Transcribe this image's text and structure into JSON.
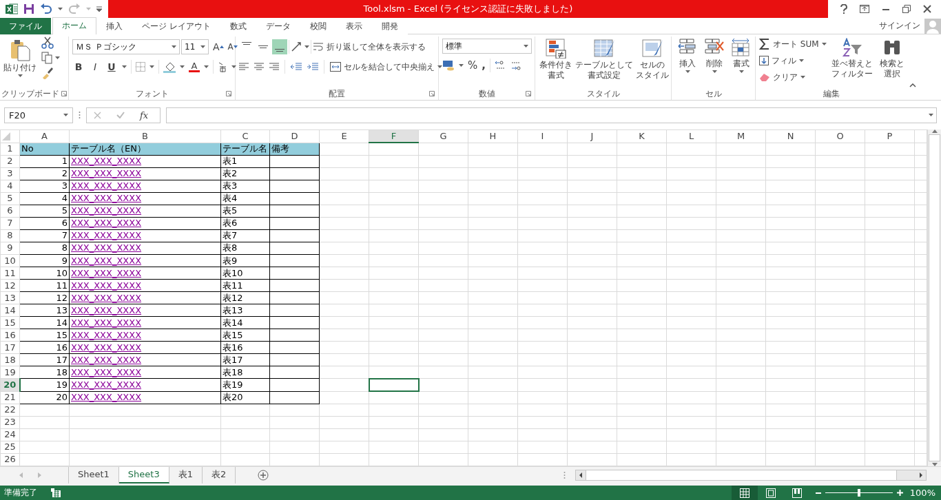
{
  "title_bar": {
    "title": "Tool.xlsm -  Excel (ライセンス認証に失敗しました)"
  },
  "ribbon_tabs": [
    {
      "label": "ファイル",
      "kind": "file",
      "selected": false
    },
    {
      "label": "ホーム",
      "kind": "tab",
      "selected": true
    },
    {
      "label": "挿入",
      "kind": "tab",
      "selected": false
    },
    {
      "label": "ページ レイアウト",
      "kind": "tab",
      "selected": false
    },
    {
      "label": "数式",
      "kind": "tab",
      "selected": false
    },
    {
      "label": "データ",
      "kind": "tab",
      "selected": false
    },
    {
      "label": "校閲",
      "kind": "tab",
      "selected": false
    },
    {
      "label": "表示",
      "kind": "tab",
      "selected": false
    },
    {
      "label": "開発",
      "kind": "tab",
      "selected": false
    }
  ],
  "account": {
    "label": "サインイン"
  },
  "clipboard": {
    "paste": "貼り付け",
    "group": "クリップボード"
  },
  "font": {
    "name": "ＭＳ Ｐゴシック",
    "size": "11",
    "grow": "A",
    "shrink": "A",
    "font_color": "A",
    "group": "フォント",
    "style_buttons": [
      {
        "label": "B",
        "kind": "bold"
      },
      {
        "label": "I",
        "kind": "italic"
      },
      {
        "label": "U",
        "kind": "underline"
      }
    ]
  },
  "alignment": {
    "wrap": "折り返して全体を表示する",
    "merge": "セルを結合して中央揃え",
    "group": "配置",
    "vertical_buttons": [
      {
        "kind": "top",
        "selected": false
      },
      {
        "kind": "middle",
        "selected": false
      },
      {
        "kind": "bottom",
        "selected": true
      }
    ]
  },
  "number": {
    "format": "標準",
    "percent": "%",
    "comma": ",",
    "group": "数値"
  },
  "styles": {
    "buttons": [
      {
        "lines": [
          "条件付き",
          "書式"
        ]
      },
      {
        "lines": [
          "テーブルとして",
          "書式設定"
        ]
      },
      {
        "lines": [
          "セルの",
          "スタイル"
        ]
      }
    ],
    "group": "スタイル"
  },
  "cells_group": {
    "buttons": [
      "挿入",
      "削除",
      "書式"
    ],
    "group": "セル"
  },
  "editing": {
    "autosum": "オート SUM",
    "fill": "フィル",
    "clear": "クリア",
    "sort": [
      "並べ替えと",
      "フィルター"
    ],
    "find": [
      "検索と",
      "選択"
    ],
    "group": "編集"
  },
  "formula_bar": {
    "name_box": "F20",
    "fx": "fx"
  },
  "sheet": {
    "columns": [
      {
        "label": "A",
        "selected": false
      },
      {
        "label": "B",
        "selected": false
      },
      {
        "label": "C",
        "selected": false
      },
      {
        "label": "D",
        "selected": false
      },
      {
        "label": "E",
        "selected": false
      },
      {
        "label": "F",
        "selected": true
      },
      {
        "label": "G",
        "selected": false
      },
      {
        "label": "H",
        "selected": false
      },
      {
        "label": "I",
        "selected": false
      },
      {
        "label": "J",
        "selected": false
      },
      {
        "label": "K",
        "selected": false
      },
      {
        "label": "L",
        "selected": false
      },
      {
        "label": "M",
        "selected": false
      },
      {
        "label": "N",
        "selected": false
      },
      {
        "label": "O",
        "selected": false
      },
      {
        "label": "P",
        "selected": false
      }
    ],
    "rows": [
      {
        "header": "1",
        "selected": false,
        "cells": [
          {
            "text": "No",
            "kind": "header"
          },
          {
            "text": "テーブル名（EN）",
            "kind": "header"
          },
          {
            "text": "テーブル名",
            "kind": "header"
          },
          {
            "text": "備考",
            "kind": "header"
          }
        ]
      },
      {
        "header": "2",
        "selected": false,
        "cells": [
          {
            "text": "1",
            "kind": "number"
          },
          {
            "text": "XXX_XXX_XXXX",
            "kind": "link"
          },
          {
            "text": "表1",
            "kind": "text"
          },
          {
            "kind": "blank"
          }
        ]
      },
      {
        "header": "3",
        "selected": false,
        "cells": [
          {
            "text": "2",
            "kind": "number"
          },
          {
            "text": "XXX_XXX_XXXX",
            "kind": "link"
          },
          {
            "text": "表2",
            "kind": "text"
          },
          {
            "kind": "blank"
          }
        ]
      },
      {
        "header": "4",
        "selected": false,
        "cells": [
          {
            "text": "3",
            "kind": "number"
          },
          {
            "text": "XXX_XXX_XXXX",
            "kind": "link"
          },
          {
            "text": "表3",
            "kind": "text"
          },
          {
            "kind": "blank"
          }
        ]
      },
      {
        "header": "5",
        "selected": false,
        "cells": [
          {
            "text": "4",
            "kind": "number"
          },
          {
            "text": "XXX_XXX_XXXX",
            "kind": "link"
          },
          {
            "text": "表4",
            "kind": "text"
          },
          {
            "kind": "blank"
          }
        ]
      },
      {
        "header": "6",
        "selected": false,
        "cells": [
          {
            "text": "5",
            "kind": "number"
          },
          {
            "text": "XXX_XXX_XXXX",
            "kind": "link"
          },
          {
            "text": "表5",
            "kind": "text"
          },
          {
            "kind": "blank"
          }
        ]
      },
      {
        "header": "7",
        "selected": false,
        "cells": [
          {
            "text": "6",
            "kind": "number"
          },
          {
            "text": "XXX_XXX_XXXX",
            "kind": "link"
          },
          {
            "text": "表6",
            "kind": "text"
          },
          {
            "kind": "blank"
          }
        ]
      },
      {
        "header": "8",
        "selected": false,
        "cells": [
          {
            "text": "7",
            "kind": "number"
          },
          {
            "text": "XXX_XXX_XXXX",
            "kind": "link"
          },
          {
            "text": "表7",
            "kind": "text"
          },
          {
            "kind": "blank"
          }
        ]
      },
      {
        "header": "9",
        "selected": false,
        "cells": [
          {
            "text": "8",
            "kind": "number"
          },
          {
            "text": "XXX_XXX_XXXX",
            "kind": "link"
          },
          {
            "text": "表8",
            "kind": "text"
          },
          {
            "kind": "blank"
          }
        ]
      },
      {
        "header": "10",
        "selected": false,
        "cells": [
          {
            "text": "9",
            "kind": "number"
          },
          {
            "text": "XXX_XXX_XXXX",
            "kind": "link"
          },
          {
            "text": "表9",
            "kind": "text"
          },
          {
            "kind": "blank"
          }
        ]
      },
      {
        "header": "11",
        "selected": false,
        "cells": [
          {
            "text": "10",
            "kind": "number"
          },
          {
            "text": "XXX_XXX_XXXX",
            "kind": "link"
          },
          {
            "text": "表10",
            "kind": "text"
          },
          {
            "kind": "blank"
          }
        ]
      },
      {
        "header": "12",
        "selected": false,
        "cells": [
          {
            "text": "11",
            "kind": "number"
          },
          {
            "text": "XXX_XXX_XXXX",
            "kind": "link"
          },
          {
            "text": "表11",
            "kind": "text"
          },
          {
            "kind": "blank"
          }
        ]
      },
      {
        "header": "13",
        "selected": false,
        "cells": [
          {
            "text": "12",
            "kind": "number"
          },
          {
            "text": "XXX_XXX_XXXX",
            "kind": "link"
          },
          {
            "text": "表12",
            "kind": "text"
          },
          {
            "kind": "blank"
          }
        ]
      },
      {
        "header": "14",
        "selected": false,
        "cells": [
          {
            "text": "13",
            "kind": "number"
          },
          {
            "text": "XXX_XXX_XXXX",
            "kind": "link"
          },
          {
            "text": "表13",
            "kind": "text"
          },
          {
            "kind": "blank"
          }
        ]
      },
      {
        "header": "15",
        "selected": false,
        "cells": [
          {
            "text": "14",
            "kind": "number"
          },
          {
            "text": "XXX_XXX_XXXX",
            "kind": "link"
          },
          {
            "text": "表14",
            "kind": "text"
          },
          {
            "kind": "blank"
          }
        ]
      },
      {
        "header": "16",
        "selected": false,
        "cells": [
          {
            "text": "15",
            "kind": "number"
          },
          {
            "text": "XXX_XXX_XXXX",
            "kind": "link"
          },
          {
            "text": "表15",
            "kind": "text"
          },
          {
            "kind": "blank"
          }
        ]
      },
      {
        "header": "17",
        "selected": false,
        "cells": [
          {
            "text": "16",
            "kind": "number"
          },
          {
            "text": "XXX_XXX_XXXX",
            "kind": "link"
          },
          {
            "text": "表16",
            "kind": "text"
          },
          {
            "kind": "blank"
          }
        ]
      },
      {
        "header": "18",
        "selected": false,
        "cells": [
          {
            "text": "17",
            "kind": "number"
          },
          {
            "text": "XXX_XXX_XXXX",
            "kind": "link"
          },
          {
            "text": "表17",
            "kind": "text"
          },
          {
            "kind": "blank"
          }
        ]
      },
      {
        "header": "19",
        "selected": false,
        "cells": [
          {
            "text": "18",
            "kind": "number"
          },
          {
            "text": "XXX_XXX_XXXX",
            "kind": "link"
          },
          {
            "text": "表18",
            "kind": "text"
          },
          {
            "kind": "blank"
          }
        ]
      },
      {
        "header": "20",
        "selected": true,
        "cells": [
          {
            "text": "19",
            "kind": "number"
          },
          {
            "text": "XXX_XXX_XXXX",
            "kind": "link"
          },
          {
            "text": "表19",
            "kind": "text"
          },
          {
            "kind": "blank"
          }
        ]
      },
      {
        "header": "21",
        "selected": false,
        "cells": [
          {
            "text": "20",
            "kind": "number"
          },
          {
            "text": "XXX_XXX_XXXX",
            "kind": "link"
          },
          {
            "text": "表20",
            "kind": "text"
          },
          {
            "kind": "blank"
          }
        ]
      },
      {
        "header": "22",
        "selected": false
      },
      {
        "header": "23",
        "selected": false
      },
      {
        "header": "24",
        "selected": false
      },
      {
        "header": "25",
        "selected": false
      },
      {
        "header": "26",
        "selected": false
      }
    ]
  },
  "sheet_tabs": [
    {
      "label": "Sheet1",
      "selected": false
    },
    {
      "label": "Sheet3",
      "selected": true
    },
    {
      "label": "表1",
      "selected": false
    },
    {
      "label": "表2",
      "selected": false
    }
  ],
  "status_bar": {
    "status": "準備完了",
    "zoom": "100%",
    "zoom_slider": {
      "level": 0.5
    },
    "views": [
      {
        "kind": "normal",
        "selected": true
      },
      {
        "kind": "page_layout",
        "selected": false
      },
      {
        "kind": "page_break",
        "selected": false
      }
    ]
  }
}
